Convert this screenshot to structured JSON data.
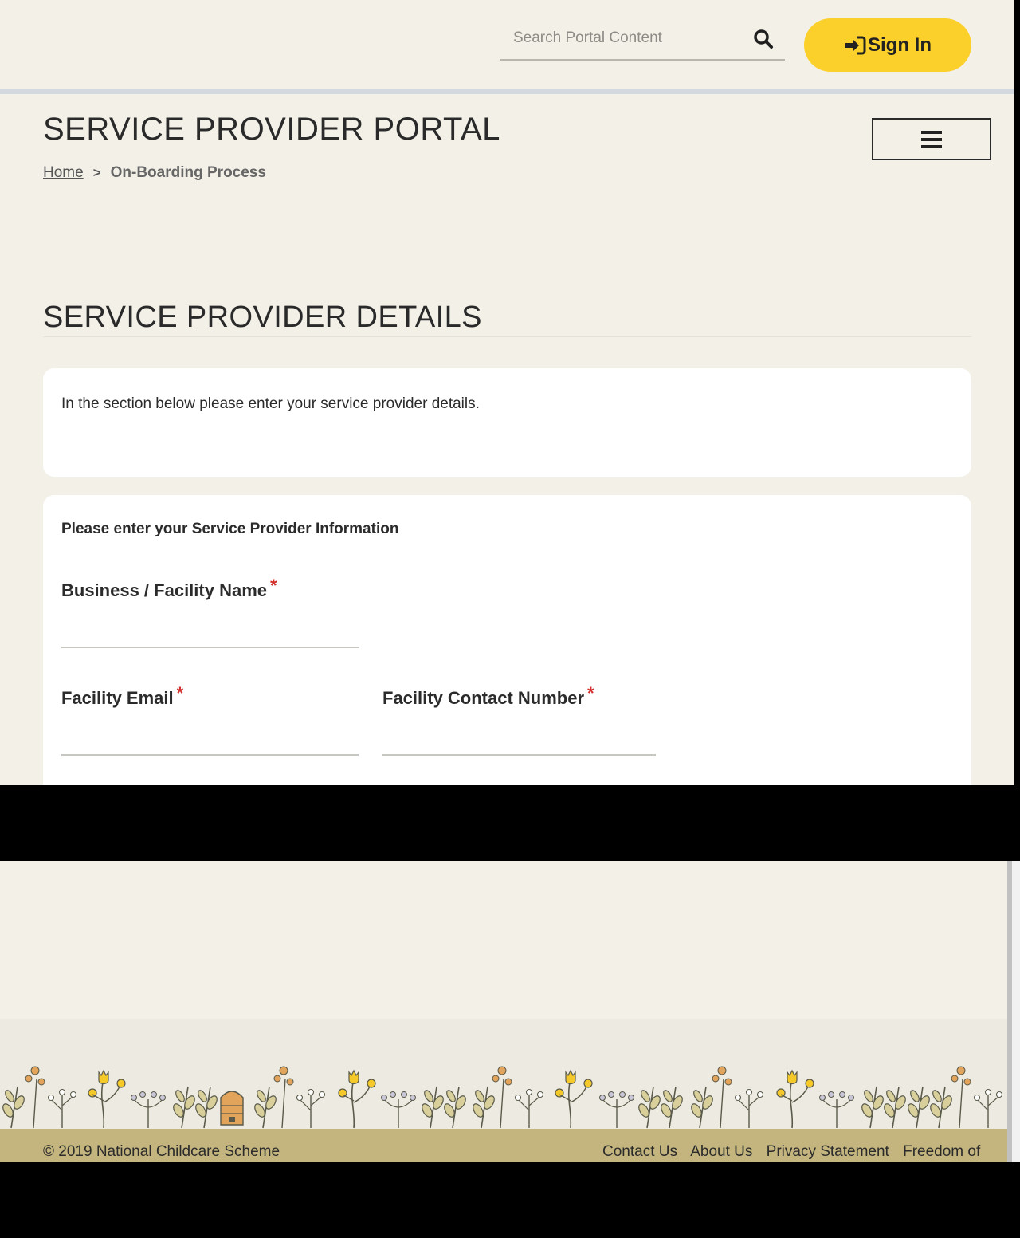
{
  "header": {
    "search_placeholder": "Search Portal Content",
    "signin_label": "Sign In"
  },
  "portal": {
    "title": "SERVICE PROVIDER PORTAL",
    "breadcrumb": {
      "home": "Home",
      "separator": ">",
      "current": "On-Boarding Process"
    }
  },
  "section": {
    "title": "SERVICE PROVIDER DETAILS",
    "intro_text": "In the section below please enter your service provider details."
  },
  "form": {
    "heading": "Please enter your Service Provider Information",
    "business_name_label": "Business / Facility Name",
    "facility_email_label": "Facility Email",
    "facility_contact_label": "Facility Contact Number",
    "required_marker": "*"
  },
  "footer": {
    "copyright": "© 2019 National Childcare Scheme",
    "links": [
      "Contact Us",
      "About Us",
      "Privacy Statement",
      "Freedom of"
    ]
  },
  "colors": {
    "background": "#f3f0e8",
    "accent_yellow": "#fcd02a",
    "footer_bar": "#c4b57f",
    "required_red": "#d32f2f"
  },
  "icons": {
    "search": "search-icon",
    "signin": "sign-in-icon",
    "menu": "hamburger-menu-icon"
  }
}
